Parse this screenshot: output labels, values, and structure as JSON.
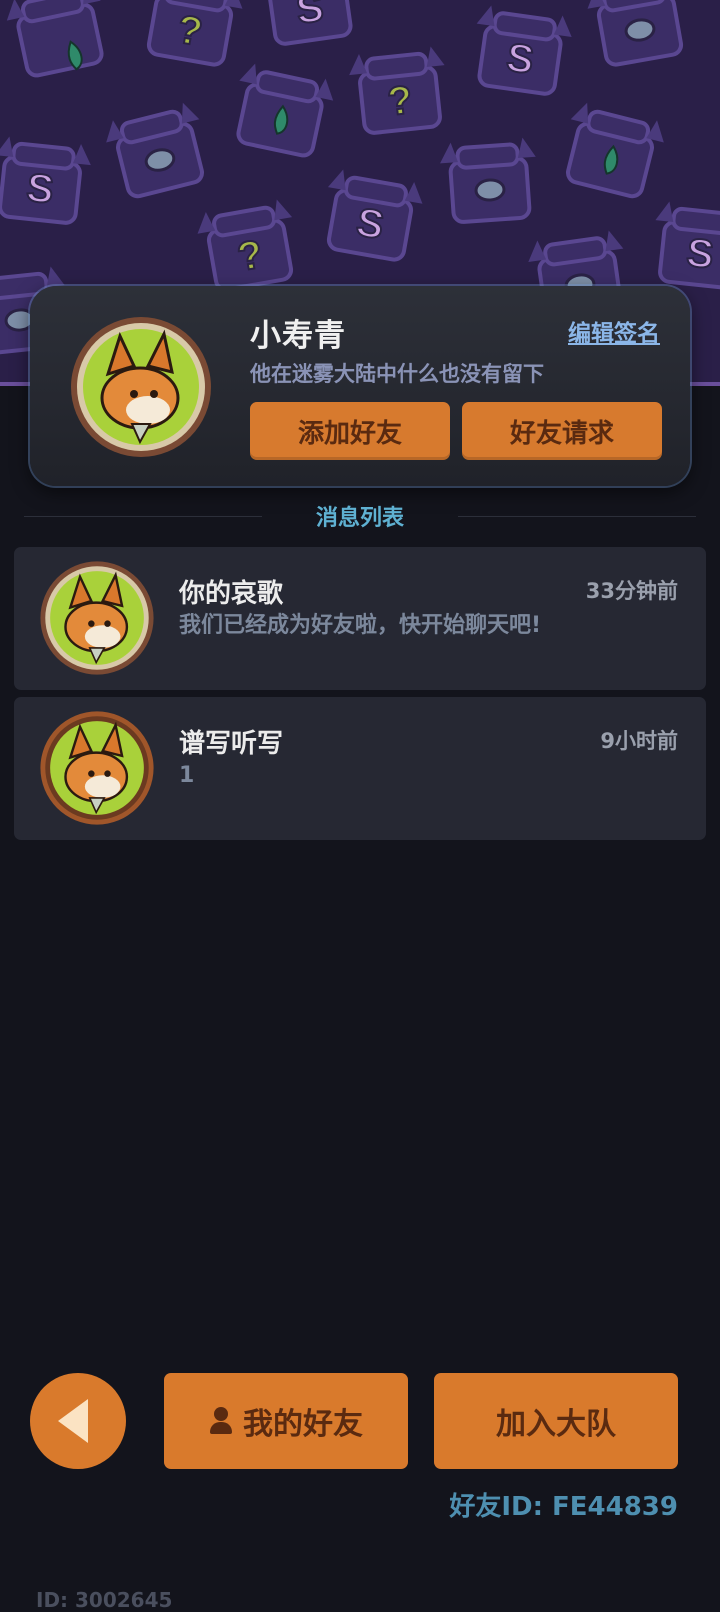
{
  "profile": {
    "name": "小寿青",
    "edit_signature": "编辑签名",
    "signature": "他在迷雾大陆中什么也没有留下",
    "add_friend": "添加好友",
    "friend_requests": "好友请求"
  },
  "messages": {
    "title": "消息列表",
    "items": [
      {
        "name": "你的哀歌",
        "time": "33分钟前",
        "text": "我们已经成为好友啦，快开始聊天吧!"
      },
      {
        "name": "谱写听写",
        "time": "9小时前",
        "text": "1"
      }
    ]
  },
  "bottom": {
    "my_friends": "我的好友",
    "join_team": "加入大队",
    "friend_id": "好友ID: FE44839",
    "user_id": "ID: 3002645"
  },
  "colors": {
    "accent_orange": "#d97a2c",
    "banner_purple": "#2a1f48",
    "title_blue": "#5fb1d2",
    "background": "#13141c"
  },
  "icons": [
    "back-arrow-icon",
    "person-icon",
    "fox-avatar-icon"
  ]
}
